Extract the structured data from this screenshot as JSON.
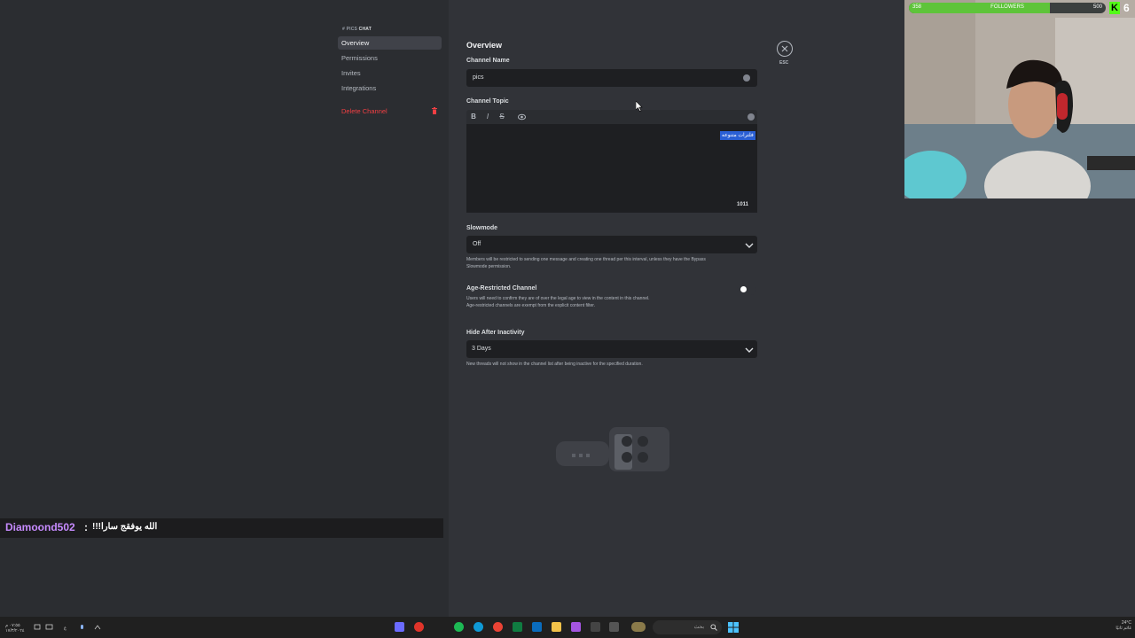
{
  "sidebar": {
    "category_prefix": "# PICS",
    "category_name": "CHAT",
    "items": [
      {
        "label": "Overview",
        "active": true
      },
      {
        "label": "Permissions"
      },
      {
        "label": "Invites"
      },
      {
        "label": "Integrations"
      }
    ],
    "delete_label": "Delete Channel"
  },
  "chat_overlay": {
    "username": "Diamoond502",
    "separator": ":",
    "message": "الله يوفقج سارا!!!"
  },
  "overview": {
    "title": "Overview",
    "channel_name_label": "Channel Name",
    "channel_name_value": "pics",
    "channel_topic_label": "Channel Topic",
    "topic_toolbar": [
      "B",
      "I",
      "S"
    ],
    "topic_selected_text": "فلترات متنوعه",
    "topic_char_count": "1011",
    "slowmode_label": "Slowmode",
    "slowmode_value": "Off",
    "slowmode_help_1": "Members will be restricted to sending one message and creating one thread per this interval, unless they have the Bypass",
    "slowmode_help_2": "Slowmode permission.",
    "age_label": "Age-Restricted Channel",
    "age_help_1": "Users will need to confirm they are of over the legal age to view in the content in this channel.",
    "age_help_2": "Age-restricted channels are exempt from the explicit content filter.",
    "hide_label": "Hide After Inactivity",
    "hide_value": "3 Days",
    "hide_help": "New threads will not show in the channel list after being inactive for the specified duration.",
    "esc_label": "ESC"
  },
  "stream_overlay": {
    "followers_current": "358",
    "followers_label": "FOLLOWERS",
    "followers_goal": "500",
    "followers_fraction": 0.716,
    "platform_badge": "K",
    "badge_number": "6"
  },
  "taskbar": {
    "search_placeholder": "بحث",
    "weather": "24°C",
    "weather_desc": "غائم ثانيًا",
    "time": "٠٧:٥٥ م",
    "date": "١٧/٣/٢٠٢٤"
  },
  "colors": {
    "accent_selection": "#2a5fd4",
    "danger": "#f23f43",
    "kick_green": "#53fc18",
    "username": "#c78bff"
  }
}
